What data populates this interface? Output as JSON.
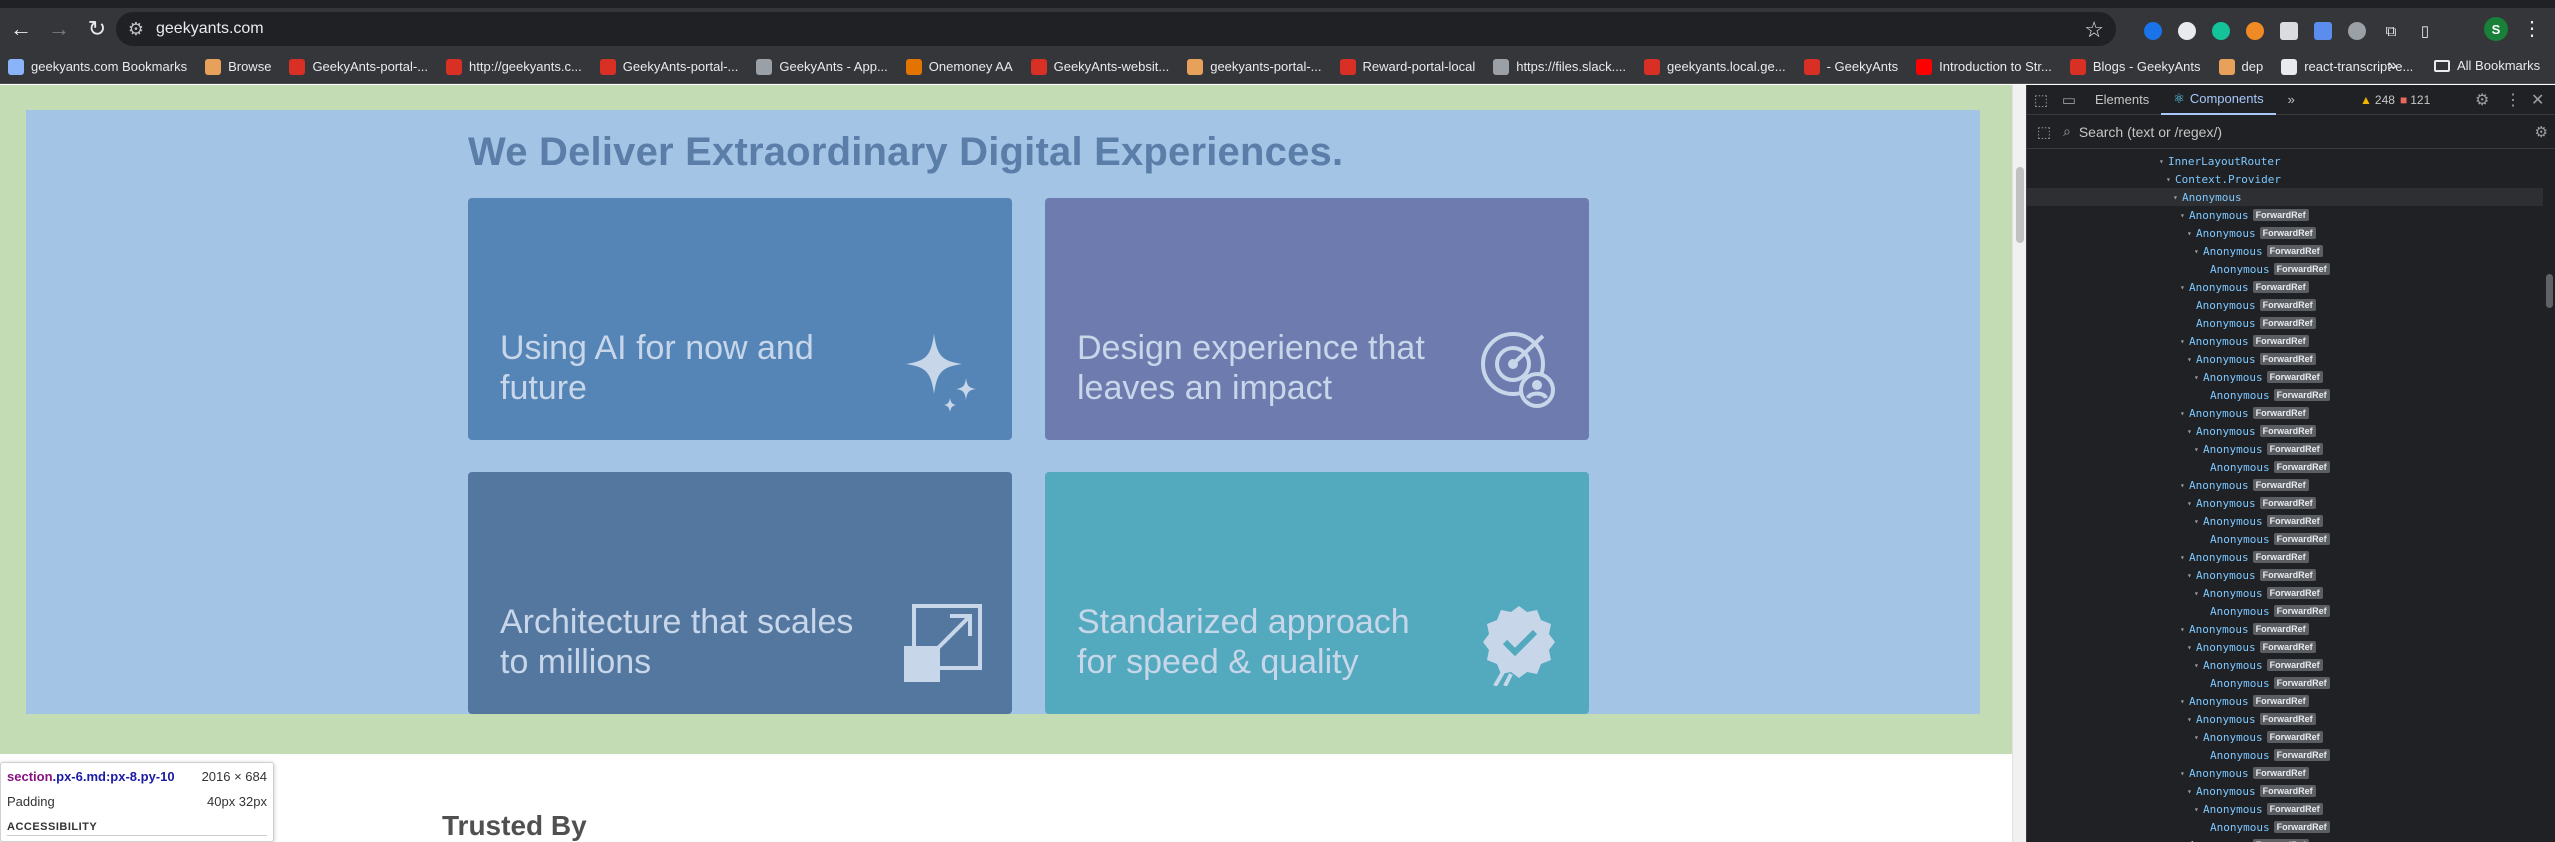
{
  "browser": {
    "url": "geekyants.com",
    "bookmarks": [
      {
        "label": "geekyants.com Bookmarks",
        "color": "#8ab4f8"
      },
      {
        "label": "Browse",
        "color": "#e8a15a"
      },
      {
        "label": "GeekyAnts-portal-...",
        "color": "#d93025"
      },
      {
        "label": "http://geekyants.c...",
        "color": "#d93025"
      },
      {
        "label": "GeekyAnts-portal-...",
        "color": "#d93025"
      },
      {
        "label": "GeekyAnts - App...",
        "color": "#9aa0a6"
      },
      {
        "label": "Onemoney AA",
        "color": "#e37400"
      },
      {
        "label": "GeekyAnts-websit...",
        "color": "#d93025"
      },
      {
        "label": "geekyants-portal-...",
        "color": "#e8a15a"
      },
      {
        "label": "Reward-portal-local",
        "color": "#d93025"
      },
      {
        "label": "https://files.slack....",
        "color": "#9aa0a6"
      },
      {
        "label": "geekyants.local.ge...",
        "color": "#d93025"
      },
      {
        "label": "- GeekyAnts",
        "color": "#d93025"
      },
      {
        "label": "Introduction to Str...",
        "color": "#ff0000"
      },
      {
        "label": "Blogs - GeekyAnts",
        "color": "#d93025"
      },
      {
        "label": "dep",
        "color": "#e8a15a"
      },
      {
        "label": "react-transcript-e...",
        "color": "#e8eaed"
      }
    ],
    "more": "»",
    "all_bookmarks": "All Bookmarks",
    "profile_initial": "S"
  },
  "page": {
    "heading": "We Deliver Extraordinary Digital Experiences.",
    "cards": [
      {
        "label": "Using AI for now and future",
        "icon": "sparkles-icon"
      },
      {
        "label": "Design experience that leaves an impact",
        "icon": "design-target-user-icon"
      },
      {
        "label": "Architecture that scales to millions",
        "icon": "scale-expand-icon"
      },
      {
        "label": "Standarized approach for speed & quality",
        "icon": "quality-badge-icon"
      }
    ],
    "trusted_by": "Trusted By"
  },
  "inspect_tooltip": {
    "tag": "section",
    "classes": ".px-6.md:px-8.py-10",
    "dimensions": "2016 × 684",
    "prop_label": "Padding",
    "prop_value": "40px 32px",
    "section_title": "ACCESSIBILITY"
  },
  "devtools": {
    "tabs": {
      "elements": "Elements",
      "components": "Components",
      "more": "»"
    },
    "warnings": "248",
    "errors": "121",
    "search_placeholder": "Search (text or /regex/)",
    "tree": [
      {
        "indent": 0,
        "arrow": "▾",
        "name": "InnerLayoutRouter",
        "badge": ""
      },
      {
        "indent": 1,
        "arrow": "▾",
        "name": "Context.Provider",
        "badge": ""
      },
      {
        "indent": 2,
        "arrow": "▾",
        "name": "Anonymous",
        "badge": "",
        "selected": true
      },
      {
        "indent": 3,
        "arrow": "▾",
        "name": "Anonymous",
        "badge": "ForwardRef"
      },
      {
        "indent": 4,
        "arrow": "▾",
        "name": "Anonymous",
        "badge": "ForwardRef"
      },
      {
        "indent": 5,
        "arrow": "▾",
        "name": "Anonymous",
        "badge": "ForwardRef"
      },
      {
        "indent": 6,
        "arrow": "",
        "name": "Anonymous",
        "badge": "ForwardRef"
      },
      {
        "indent": 3,
        "arrow": "▾",
        "name": "Anonymous",
        "badge": "ForwardRef"
      },
      {
        "indent": 4,
        "arrow": "",
        "name": "Anonymous",
        "badge": "ForwardRef"
      },
      {
        "indent": 4,
        "arrow": "",
        "name": "Anonymous",
        "badge": "ForwardRef"
      },
      {
        "indent": 3,
        "arrow": "▾",
        "name": "Anonymous",
        "badge": "ForwardRef"
      },
      {
        "indent": 4,
        "arrow": "▾",
        "name": "Anonymous",
        "badge": "ForwardRef"
      },
      {
        "indent": 5,
        "arrow": "▾",
        "name": "Anonymous",
        "badge": "ForwardRef"
      },
      {
        "indent": 6,
        "arrow": "",
        "name": "Anonymous",
        "badge": "ForwardRef"
      },
      {
        "indent": 3,
        "arrow": "▾",
        "name": "Anonymous",
        "badge": "ForwardRef"
      },
      {
        "indent": 4,
        "arrow": "▾",
        "name": "Anonymous",
        "badge": "ForwardRef"
      },
      {
        "indent": 5,
        "arrow": "▾",
        "name": "Anonymous",
        "badge": "ForwardRef"
      },
      {
        "indent": 6,
        "arrow": "",
        "name": "Anonymous",
        "badge": "ForwardRef"
      },
      {
        "indent": 3,
        "arrow": "▾",
        "name": "Anonymous",
        "badge": "ForwardRef"
      },
      {
        "indent": 4,
        "arrow": "▾",
        "name": "Anonymous",
        "badge": "ForwardRef"
      },
      {
        "indent": 5,
        "arrow": "▾",
        "name": "Anonymous",
        "badge": "ForwardRef"
      },
      {
        "indent": 6,
        "arrow": "",
        "name": "Anonymous",
        "badge": "ForwardRef"
      },
      {
        "indent": 3,
        "arrow": "▾",
        "name": "Anonymous",
        "badge": "ForwardRef"
      },
      {
        "indent": 4,
        "arrow": "▾",
        "name": "Anonymous",
        "badge": "ForwardRef"
      },
      {
        "indent": 5,
        "arrow": "▾",
        "name": "Anonymous",
        "badge": "ForwardRef"
      },
      {
        "indent": 6,
        "arrow": "",
        "name": "Anonymous",
        "badge": "ForwardRef"
      },
      {
        "indent": 3,
        "arrow": "▾",
        "name": "Anonymous",
        "badge": "ForwardRef"
      },
      {
        "indent": 4,
        "arrow": "▾",
        "name": "Anonymous",
        "badge": "ForwardRef"
      },
      {
        "indent": 5,
        "arrow": "▾",
        "name": "Anonymous",
        "badge": "ForwardRef"
      },
      {
        "indent": 6,
        "arrow": "",
        "name": "Anonymous",
        "badge": "ForwardRef"
      },
      {
        "indent": 3,
        "arrow": "▾",
        "name": "Anonymous",
        "badge": "ForwardRef"
      },
      {
        "indent": 4,
        "arrow": "▾",
        "name": "Anonymous",
        "badge": "ForwardRef"
      },
      {
        "indent": 5,
        "arrow": "▾",
        "name": "Anonymous",
        "badge": "ForwardRef"
      },
      {
        "indent": 6,
        "arrow": "",
        "name": "Anonymous",
        "badge": "ForwardRef"
      },
      {
        "indent": 3,
        "arrow": "▾",
        "name": "Anonymous",
        "badge": "ForwardRef"
      },
      {
        "indent": 4,
        "arrow": "▾",
        "name": "Anonymous",
        "badge": "ForwardRef"
      },
      {
        "indent": 5,
        "arrow": "▾",
        "name": "Anonymous",
        "badge": "ForwardRef"
      },
      {
        "indent": 6,
        "arrow": "",
        "name": "Anonymous",
        "badge": "ForwardRef"
      },
      {
        "indent": 3,
        "arrow": "▾",
        "name": "Anonymous",
        "badge": "ForwardRef"
      }
    ]
  },
  "colors": {
    "section_outer": "#c4dcb4",
    "section_inner": "#a4c4e6",
    "heading": "#5a7ea8",
    "devtools_bg": "#202124"
  }
}
